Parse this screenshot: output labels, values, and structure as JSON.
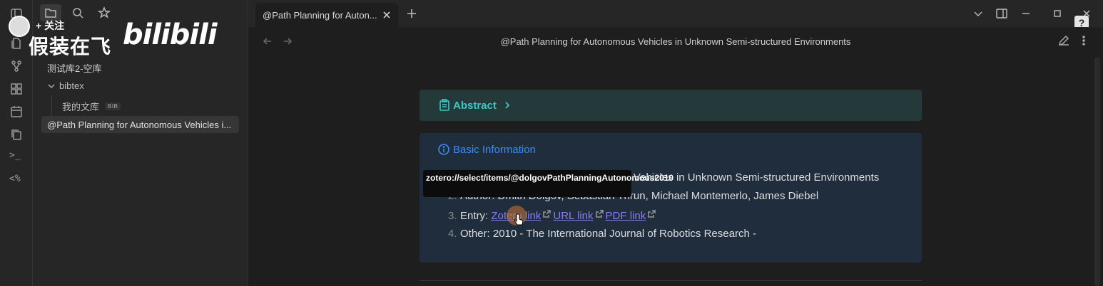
{
  "watermark": {
    "follow_label": "+ 关注",
    "channel_name": "假装在飞",
    "logo": "bilibili"
  },
  "sidebar": {
    "vault_name": "测试库2-空库",
    "folder": "bibtex",
    "file": "我的文库",
    "file_badge": "BIB",
    "active_note": "@Path Planning for Autonomous Vehicles i..."
  },
  "ribbon": {
    "template_label": ">_",
    "percent_label": "<%"
  },
  "tab": {
    "title": "@Path Planning for Auton..."
  },
  "header": {
    "note_title": "@Path Planning for Autonomous Vehicles in Unknown Semi-structured Environments"
  },
  "abstract": {
    "title": "Abstract"
  },
  "basic_info": {
    "title": "Basic Information",
    "line1_num": "1.",
    "line1_text": "Title: Path Planning for Autonomous Vehicles in Unknown Semi-structured Environments",
    "line2_num": "2.",
    "line2_text": "Author: Dmitri Dolgov, Sebastian Thrun, Michael Montemerlo, James Diebel",
    "line3_num": "3.",
    "line3_prefix": "Entry: ",
    "zotero_link": "Zotero link",
    "url_link": "URL link",
    "pdf_link": "PDF link",
    "line4_num": "4.",
    "line4_text": "Other: 2010 - The International Journal of Robotics Research -"
  },
  "tooltip": {
    "text": "zotero://select/items/@dolgovPathPlanningAutonomous2010"
  },
  "help_label": "?",
  "colors": {
    "background": "#1e1e1e",
    "sidebar": "#262626",
    "abstract_accent": "#3fc6c4",
    "info_accent": "#3d8bf0",
    "link": "#8a7cf0"
  }
}
